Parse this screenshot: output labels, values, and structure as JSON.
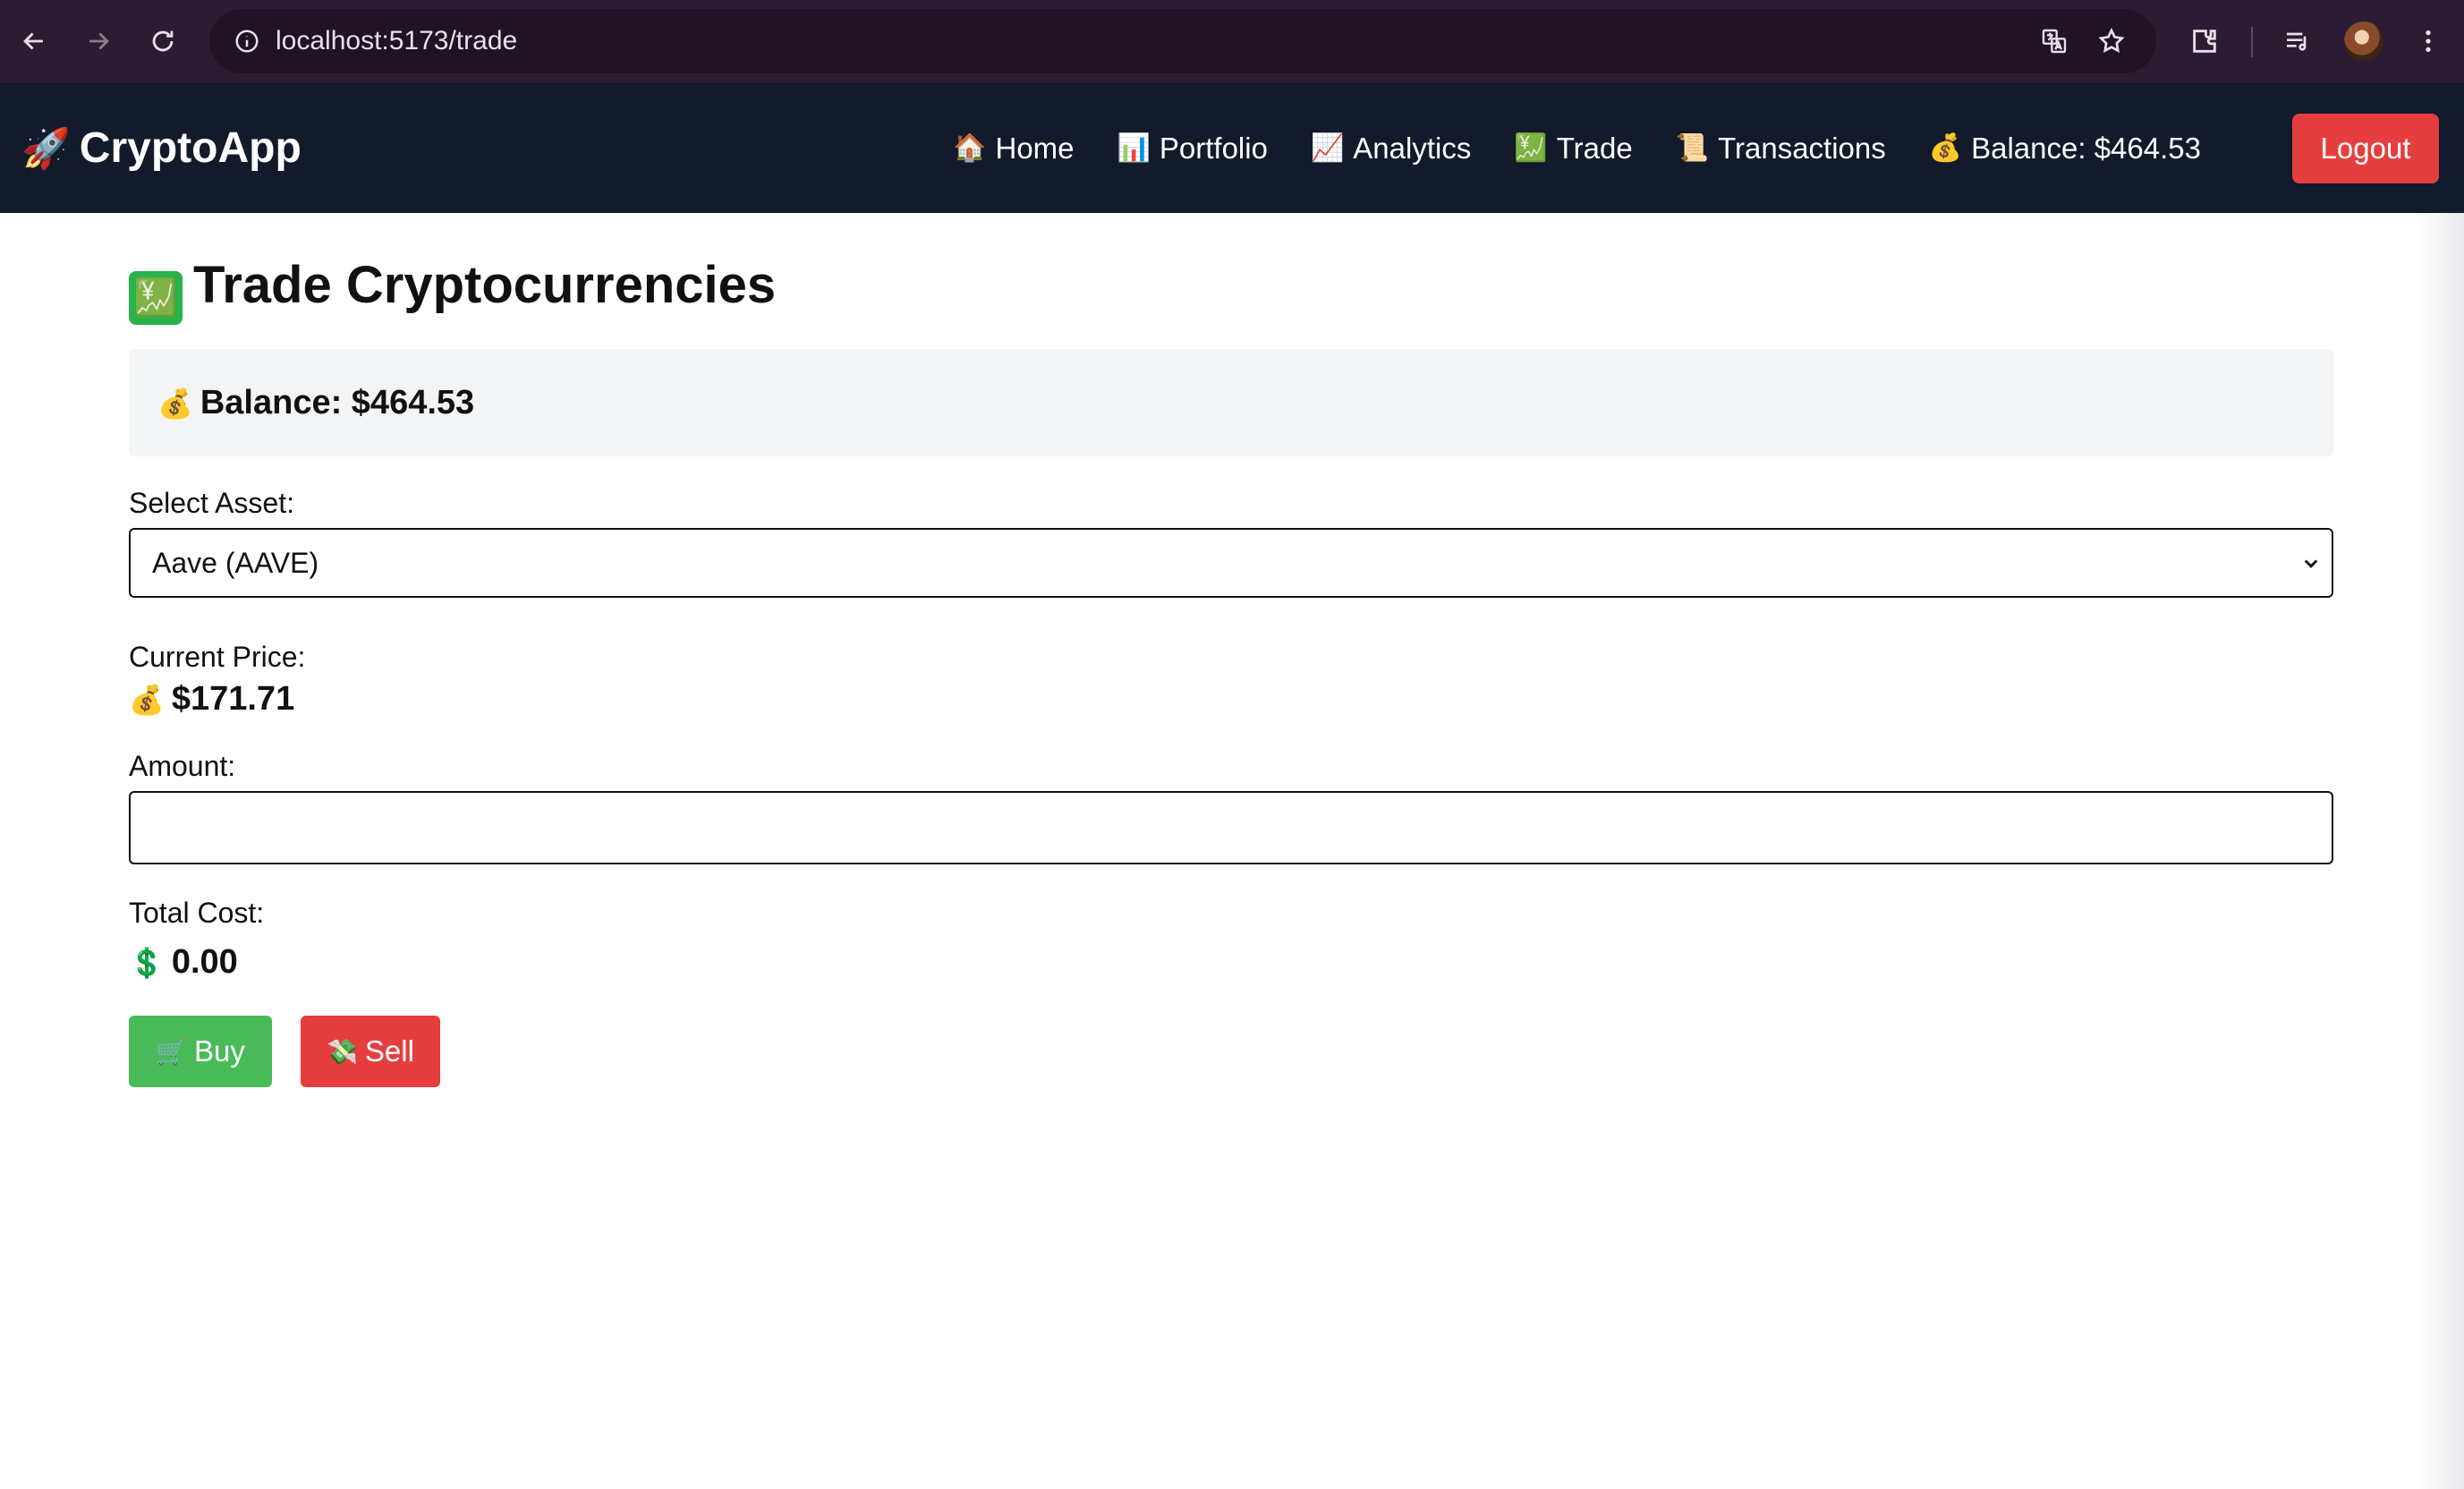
{
  "browser": {
    "url": "localhost:5173/trade"
  },
  "navbar": {
    "brand_icon": "🚀",
    "brand": "CryptoApp",
    "links": [
      {
        "icon": "🏠",
        "label": "Home"
      },
      {
        "icon": "📊",
        "label": "Portfolio"
      },
      {
        "icon": "📈",
        "label": "Analytics"
      },
      {
        "icon": "💹",
        "label": "Trade"
      },
      {
        "icon": "📜",
        "label": "Transactions"
      }
    ],
    "balance_icon": "💰",
    "balance_text": "Balance: $464.53",
    "logout_label": "Logout"
  },
  "page": {
    "title_icon": "💹",
    "title": "Trade Cryptocurrencies",
    "balance_icon": "💰",
    "balance_text": "Balance: $464.53",
    "select_label": "Select Asset:",
    "selected_asset": "Aave (AAVE)",
    "price_label": "Current Price:",
    "price_icon": "💰",
    "price_value": "$171.71",
    "amount_label": "Amount:",
    "amount_value": "",
    "total_label": "Total Cost:",
    "total_icon": "💲",
    "total_value": "0.00",
    "buy_icon": "🛒",
    "buy_label": "Buy",
    "sell_icon": "💸",
    "sell_label": "Sell"
  },
  "colors": {
    "navbar_bg": "#121a2b",
    "logout_red": "#e53e3e",
    "buy_green": "#48bb58",
    "sell_red": "#e53e3e",
    "balance_card_bg": "#f3f4f6"
  }
}
